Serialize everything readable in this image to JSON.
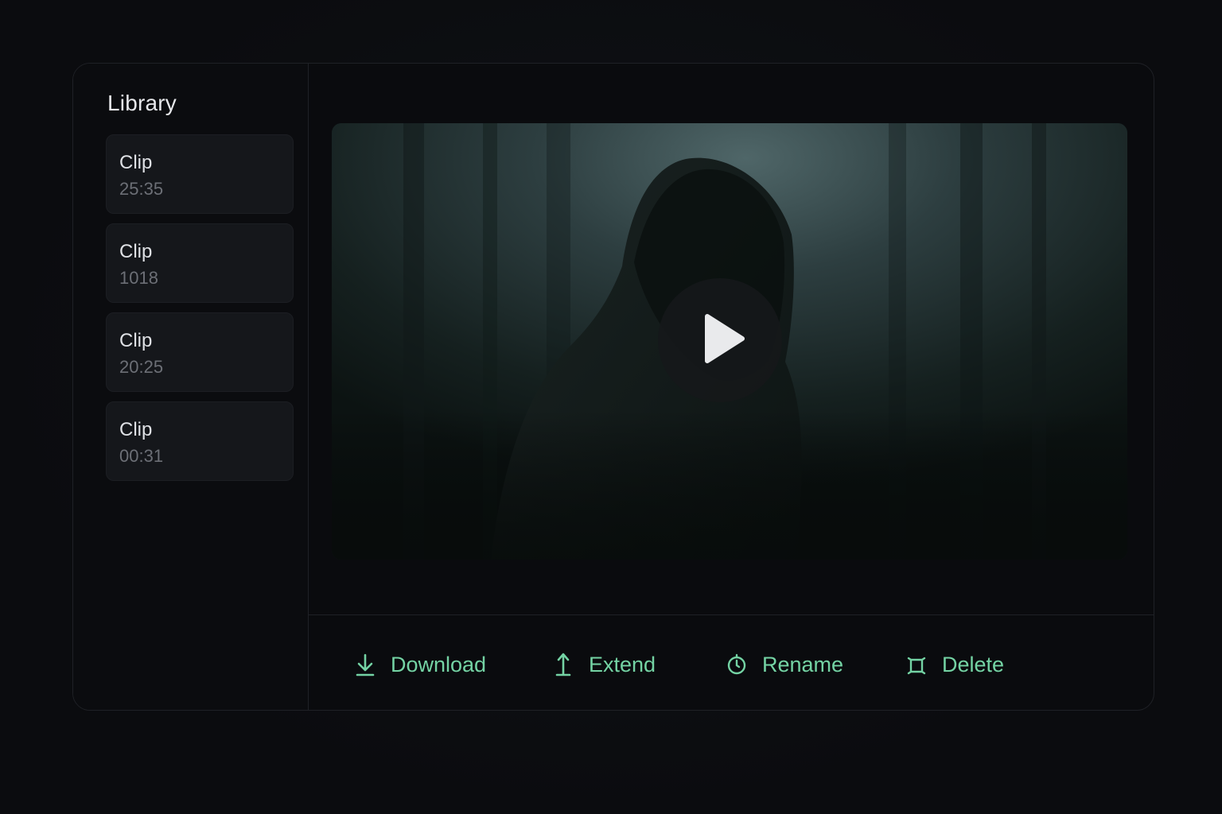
{
  "sidebar": {
    "title": "Library",
    "clips": [
      {
        "name": "Clip",
        "duration": "25:35"
      },
      {
        "name": "Clip",
        "duration": "1018"
      },
      {
        "name": "Clip",
        "duration": "20:25"
      },
      {
        "name": "Clip",
        "duration": "00:31"
      }
    ]
  },
  "player": {
    "play_icon": "play-icon"
  },
  "actions": {
    "download": {
      "label": "Download",
      "icon": "download-icon"
    },
    "extend": {
      "label": "Extend",
      "icon": "extend-arrow-icon"
    },
    "rename": {
      "label": "Rename",
      "icon": "timer-icon"
    },
    "delete": {
      "label": "Delete",
      "icon": "crop-square-icon"
    }
  },
  "colors": {
    "accent": "#74d3a4",
    "background": "#0a0b0e",
    "card": "#15171b"
  }
}
